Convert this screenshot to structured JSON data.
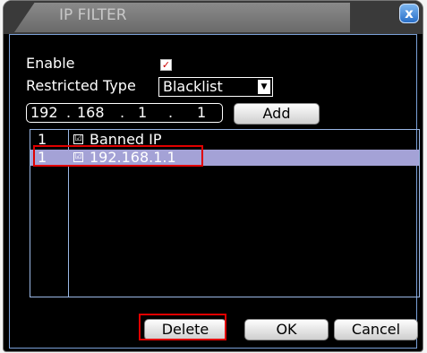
{
  "title": "IP FILTER",
  "close_glyph": "x",
  "enable": {
    "label": "Enable",
    "checked": true,
    "check_glyph": "✓"
  },
  "restricted_type": {
    "label": "Restricted Type",
    "value": "Blacklist",
    "arrow": "▼"
  },
  "ip_input": {
    "octets": [
      "192",
      "168",
      "1",
      "1"
    ],
    "separator": "."
  },
  "buttons": {
    "add": "Add",
    "delete": "Delete",
    "ok": "OK",
    "cancel": "Cancel"
  },
  "table": {
    "header": {
      "index": "1",
      "checked": "☑",
      "label": "Banned IP"
    },
    "rows": [
      {
        "index": "1",
        "checked": "☑",
        "ip": "192.168.1.1",
        "selected": true
      }
    ]
  },
  "colors": {
    "highlight": "#e00000",
    "selection": "#a4a2d6",
    "accent": "#2a6fc8"
  }
}
